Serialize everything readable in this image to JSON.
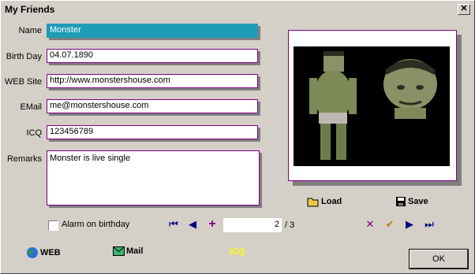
{
  "window": {
    "title": "My Friends",
    "close_glyph": "✕"
  },
  "form": {
    "name_label": "Name",
    "name_value": "Monster",
    "birthday_label": "Birth Day",
    "birthday_value": "04.07.1890",
    "website_label": "WEB Site",
    "website_value": "http://www.monstershouse.com",
    "email_label": "EMail",
    "email_value": "me@monstershouse.com",
    "icq_label": "ICQ",
    "icq_value": "123456789",
    "remarks_label": "Remarks",
    "remarks_value": "Monster is live single",
    "alarm_label": "Alarm on birthday",
    "alarm_checked": false
  },
  "photo": {
    "load_label": "Load",
    "save_label": "Save"
  },
  "navigator": {
    "current": "2",
    "total_text": "/ 3",
    "icons": [
      "first-icon",
      "prior-icon",
      "insert-icon",
      "delete-icon",
      "post-icon",
      "next-icon",
      "last-icon"
    ]
  },
  "links": {
    "web_label": "WEB",
    "mail_label": "Mail",
    "icq_label": "ICQ"
  },
  "buttons": {
    "ok_label": "OK"
  },
  "colors": {
    "accent": "#1e9cb8",
    "field_border": "#800080",
    "icq": "#ffff00",
    "nav": "#000080"
  }
}
